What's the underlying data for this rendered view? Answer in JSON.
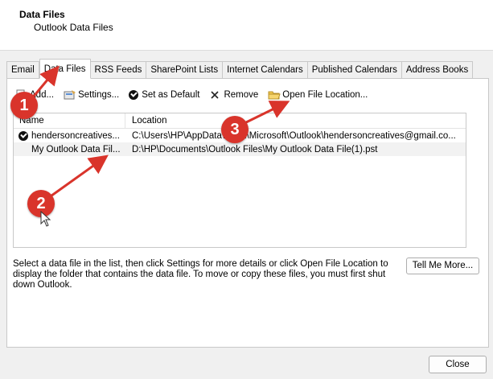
{
  "header": {
    "title": "Data Files",
    "subtitle": "Outlook Data Files"
  },
  "tabs": [
    {
      "label": "Email",
      "active": false
    },
    {
      "label": "Data Files",
      "active": true
    },
    {
      "label": "RSS Feeds",
      "active": false
    },
    {
      "label": "SharePoint Lists",
      "active": false
    },
    {
      "label": "Internet Calendars",
      "active": false
    },
    {
      "label": "Published Calendars",
      "active": false
    },
    {
      "label": "Address Books",
      "active": false
    }
  ],
  "toolbar": {
    "add_label": "Add...",
    "settings_label": "Settings...",
    "default_label": "Set as Default",
    "remove_label": "Remove",
    "open_label": "Open File Location..."
  },
  "list": {
    "columns": {
      "name": "Name",
      "location": "Location"
    },
    "rows": [
      {
        "name": "hendersoncreatives...",
        "location": "C:\\Users\\HP\\AppData\\Local\\Microsoft\\Outlook\\hendersoncreatives@gmail.co...",
        "default": true
      },
      {
        "name": "My Outlook Data Fil...",
        "location": "D:\\HP\\Documents\\Outlook Files\\My Outlook Data File(1).pst",
        "default": false
      }
    ]
  },
  "description": "Select a data file in the list, then click Settings for more details or click Open File Location to display the folder that contains the data file. To move or copy these files, you must first shut down Outlook.",
  "buttons": {
    "tell_me_more": "Tell Me More...",
    "close": "Close"
  },
  "annotations": {
    "badge1": "1",
    "badge2": "2",
    "badge3": "3",
    "color": "#d9342b"
  }
}
